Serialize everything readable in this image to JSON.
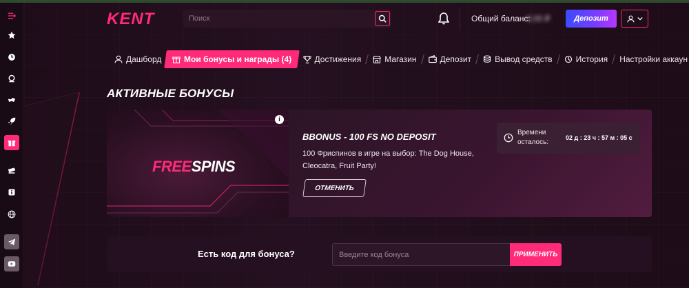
{
  "header": {
    "logo_text": "KENT",
    "search_placeholder": "Поиск",
    "balance_label": "Общий баланс:",
    "balance_value": "0,00 ₽",
    "deposit_label": "Депозит"
  },
  "tabs": [
    {
      "label": "Дашборд",
      "icon": "user-icon"
    },
    {
      "label": "Мои бонусы и награды (4)",
      "icon": "gift-icon",
      "active": true
    },
    {
      "label": "Достижения",
      "icon": "trophy-icon"
    },
    {
      "label": "Магазин",
      "icon": "shop-icon"
    },
    {
      "label": "Депозит",
      "icon": "wallet-icon"
    },
    {
      "label": "Вывод средств",
      "icon": "coins-icon"
    },
    {
      "label": "История",
      "icon": "history-icon"
    },
    {
      "label": "Настройки аккаун",
      "icon": ""
    }
  ],
  "section_title": "АКТИВНЫЕ БОНУСЫ",
  "bonus": {
    "image_text_free": "FREE",
    "image_text_spins": "SPINS",
    "name": "BBONUS - 100 FS NO DEPOSIT",
    "description": "100 Фриспинов в игре на выбор: The Dog House, Cleocatra, Fruit Party!",
    "cancel_label": "ОТМЕНИТЬ",
    "timer_label": "Времени осталось:",
    "timer_value": "02 д : 23 ч : 57 м : 05 с"
  },
  "promo": {
    "label": "Есть код для бонуса?",
    "placeholder": "Введите код бонуса",
    "apply_label": "ПРИМЕНИТЬ"
  },
  "colors": {
    "accent": "#ff2a78",
    "background": "#1c0e18",
    "card": "#2a1424"
  }
}
